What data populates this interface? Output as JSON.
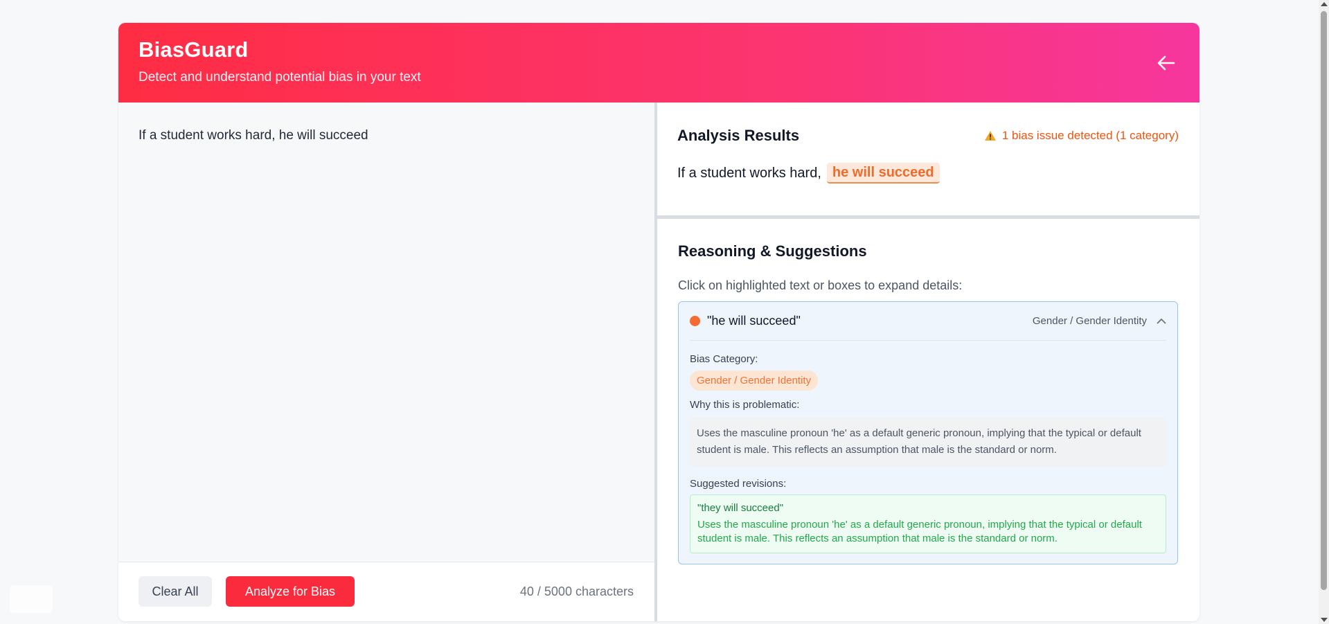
{
  "app": {
    "title": "BiasGuard",
    "subtitle": "Detect and understand potential bias in your text",
    "back_icon": "arrow-left-icon"
  },
  "colors": {
    "header_gradient": [
      "#ff2d43",
      "#f6369d"
    ],
    "primary_button": "#fb2b3e",
    "warning": "#f0530e",
    "highlight_text": "#f06b2a",
    "suggestion_green": "#22a84a"
  },
  "editor": {
    "text": "If a student works hard, he will succeed",
    "clear_label": "Clear All",
    "analyze_label": "Analyze for Bias",
    "char_count": "40 / 5000 characters"
  },
  "results": {
    "heading": "Analysis Results",
    "warning_icon": "warning-triangle-icon",
    "warning_text": "1 bias issue detected (1 category)",
    "sentence_plain": "If a student works hard,",
    "sentence_highlight": "he will succeed"
  },
  "reasoning": {
    "heading": "Reasoning & Suggestions",
    "instruction": "Click on highlighted text or boxes to expand details:",
    "issues": [
      {
        "phrase": "\"he will succeed\"",
        "category": "Gender / Gender Identity",
        "expanded": true,
        "bias_category_label": "Bias Category:",
        "category_chip": "Gender / Gender Identity",
        "why_label": "Why this is problematic:",
        "why_text": "Uses the masculine pronoun 'he' as a default generic pronoun, implying that the typical or default student is male. This reflects an assumption that male is the standard or norm.",
        "suggested_label": "Suggested revisions:",
        "revision": "\"they will succeed\"",
        "revision_explanation": "Uses the masculine pronoun 'he' as a default generic pronoun, implying that the typical or default student is male. This reflects an assumption that male is the standard or norm."
      }
    ]
  }
}
